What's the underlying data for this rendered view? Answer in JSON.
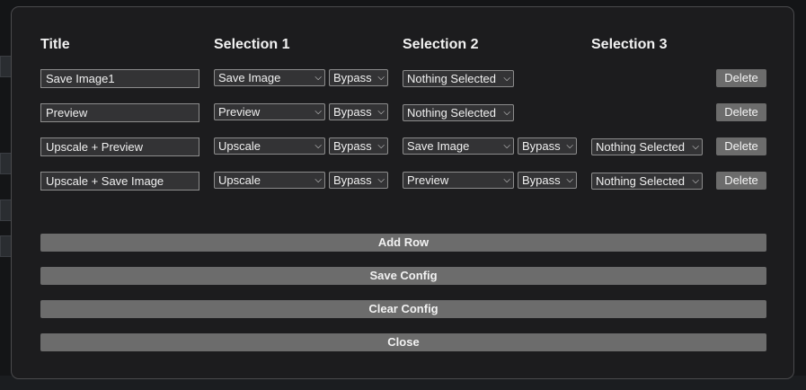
{
  "headers": [
    "Title",
    "Selection 1",
    "Selection 2",
    "Selection 3"
  ],
  "rows": [
    {
      "title": "Save Image1",
      "sel1": "Save Image",
      "sel1_mode": "Bypass",
      "sel2": "Nothing Selected",
      "sel2_mode": "",
      "sel3": "",
      "delete": "Delete"
    },
    {
      "title": "Preview",
      "sel1": "Preview",
      "sel1_mode": "Bypass",
      "sel2": "Nothing Selected",
      "sel2_mode": "",
      "sel3": "",
      "delete": "Delete"
    },
    {
      "title": "Upscale + Preview",
      "sel1": "Upscale",
      "sel1_mode": "Bypass",
      "sel2": "Save Image",
      "sel2_mode": "Bypass",
      "sel3": "Nothing Selected",
      "delete": "Delete"
    },
    {
      "title": "Upscale + Save Image",
      "sel1": "Upscale",
      "sel1_mode": "Bypass",
      "sel2": "Preview",
      "sel2_mode": "Bypass",
      "sel3": "Nothing Selected",
      "delete": "Delete"
    }
  ],
  "actions": {
    "add_row": "Add Row",
    "save_config": "Save Config",
    "clear_config": "Clear Config",
    "close": "Close"
  },
  "colors": {
    "dialog_bg": "#1c1c1e",
    "button_bg": "#6c6c6c",
    "input_bg": "#333335"
  }
}
